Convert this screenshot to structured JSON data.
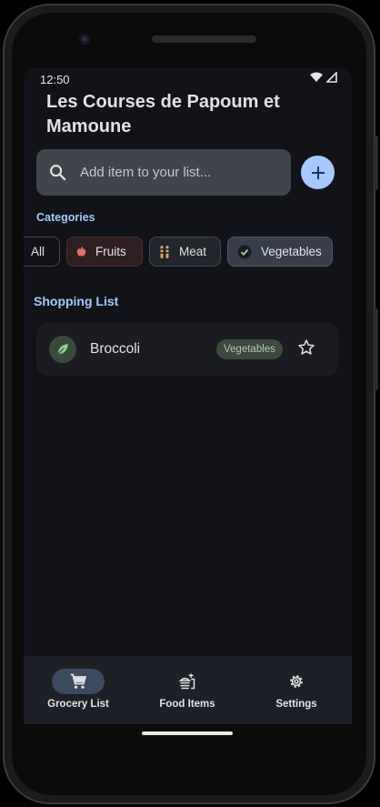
{
  "status_bar": {
    "time": "12:50"
  },
  "app": {
    "title": "Les Courses de Papoum et Mamoune"
  },
  "search": {
    "placeholder": "Add item to your list..."
  },
  "categories": {
    "label": "Categories",
    "chips": [
      {
        "label": "All",
        "icon": "none",
        "selected": false
      },
      {
        "label": "Fruits",
        "icon": "apple-icon",
        "selected": false
      },
      {
        "label": "Meat",
        "icon": "meat-icon",
        "selected": false
      },
      {
        "label": "Vegetables",
        "icon": "check-icon",
        "selected": true
      }
    ]
  },
  "shopping_list": {
    "label": "Shopping List",
    "items": [
      {
        "name": "Broccoli",
        "category": "Vegetables",
        "icon": "leaf-icon",
        "starred": false
      }
    ]
  },
  "nav": {
    "items": [
      {
        "label": "Grocery List",
        "icon": "cart-icon",
        "active": true
      },
      {
        "label": "Food Items",
        "icon": "food-icon",
        "active": false
      },
      {
        "label": "Settings",
        "icon": "gear-icon",
        "active": false
      }
    ]
  },
  "colors": {
    "background": "#111318",
    "accent": "#a6c8ff",
    "surface": "#1a1c21",
    "nav_background": "#1d2026"
  }
}
